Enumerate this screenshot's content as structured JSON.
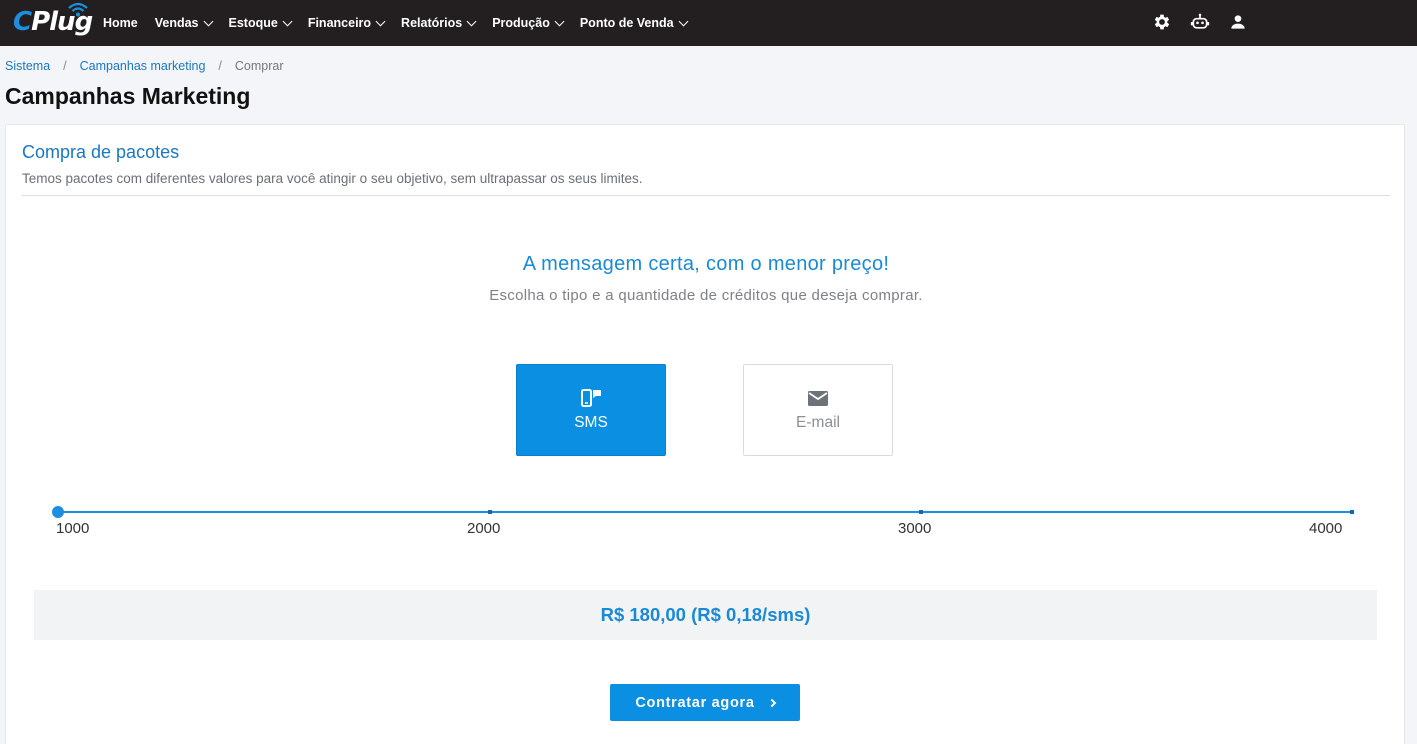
{
  "brand": {
    "logo_text_c": "C",
    "logo_text_rest": "Plug",
    "accent": "#1c8fe0",
    "topbar_bg": "#231f20"
  },
  "nav": {
    "items": [
      {
        "label": "Home",
        "dropdown": false
      },
      {
        "label": "Vendas",
        "dropdown": true
      },
      {
        "label": "Estoque",
        "dropdown": true
      },
      {
        "label": "Financeiro",
        "dropdown": true
      },
      {
        "label": "Relatórios",
        "dropdown": true
      },
      {
        "label": "Produção",
        "dropdown": true
      },
      {
        "label": "Ponto de Venda",
        "dropdown": true
      }
    ],
    "icons": [
      "gear-icon",
      "robot-icon",
      "user-icon"
    ]
  },
  "breadcrumb": {
    "items": [
      "Sistema",
      "Campanhas marketing",
      "Comprar"
    ]
  },
  "page": {
    "title": "Campanhas Marketing"
  },
  "card": {
    "title": "Compra de pacotes",
    "subtitle": "Temos pacotes com diferentes valores para você atingir o seu objetivo, sem ultrapassar os seus limites."
  },
  "promo": {
    "headline": "A mensagem certa, com o menor preço!",
    "subline": "Escolha o tipo e a quantidade de créditos que deseja comprar."
  },
  "types": {
    "sms": {
      "label": "SMS",
      "icon": "sms-icon",
      "selected": true
    },
    "email": {
      "label": "E-mail",
      "icon": "email-icon",
      "selected": false
    }
  },
  "slider": {
    "ticks": [
      "1000",
      "2000",
      "3000",
      "4000"
    ],
    "min": 1000,
    "max": 4000,
    "value": 1000
  },
  "price": {
    "text": "R$ 180,00 (R$ 0,18/sms)"
  },
  "cta": {
    "label": "Contratar agora"
  }
}
